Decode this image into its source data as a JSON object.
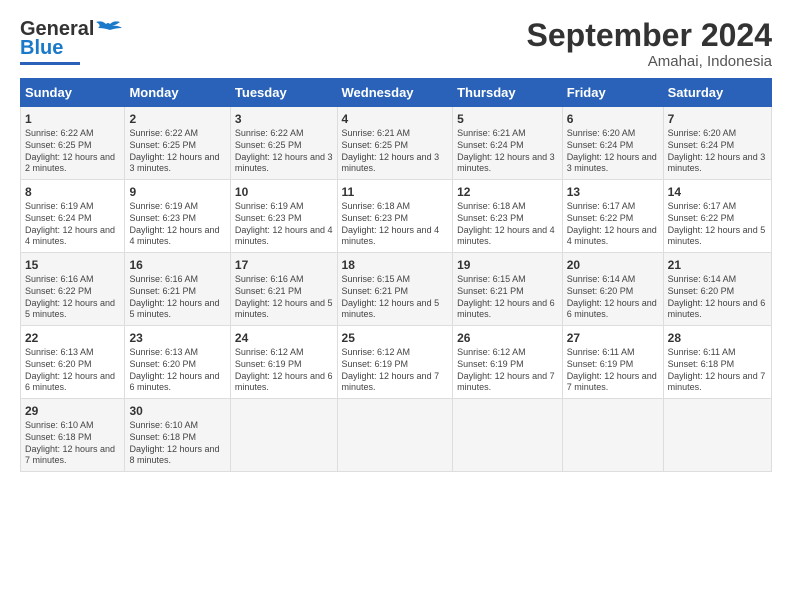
{
  "logo": {
    "line1": "General",
    "line2": "Blue"
  },
  "title": "September 2024",
  "subtitle": "Amahai, Indonesia",
  "days": [
    "Sunday",
    "Monday",
    "Tuesday",
    "Wednesday",
    "Thursday",
    "Friday",
    "Saturday"
  ],
  "weeks": [
    [
      {
        "num": "1",
        "rise": "6:22 AM",
        "set": "6:25 PM",
        "daylight": "12 hours and 2 minutes."
      },
      {
        "num": "2",
        "rise": "6:22 AM",
        "set": "6:25 PM",
        "daylight": "12 hours and 3 minutes."
      },
      {
        "num": "3",
        "rise": "6:22 AM",
        "set": "6:25 PM",
        "daylight": "12 hours and 3 minutes."
      },
      {
        "num": "4",
        "rise": "6:21 AM",
        "set": "6:25 PM",
        "daylight": "12 hours and 3 minutes."
      },
      {
        "num": "5",
        "rise": "6:21 AM",
        "set": "6:24 PM",
        "daylight": "12 hours and 3 minutes."
      },
      {
        "num": "6",
        "rise": "6:20 AM",
        "set": "6:24 PM",
        "daylight": "12 hours and 3 minutes."
      },
      {
        "num": "7",
        "rise": "6:20 AM",
        "set": "6:24 PM",
        "daylight": "12 hours and 3 minutes."
      }
    ],
    [
      {
        "num": "8",
        "rise": "6:19 AM",
        "set": "6:24 PM",
        "daylight": "12 hours and 4 minutes."
      },
      {
        "num": "9",
        "rise": "6:19 AM",
        "set": "6:23 PM",
        "daylight": "12 hours and 4 minutes."
      },
      {
        "num": "10",
        "rise": "6:19 AM",
        "set": "6:23 PM",
        "daylight": "12 hours and 4 minutes."
      },
      {
        "num": "11",
        "rise": "6:18 AM",
        "set": "6:23 PM",
        "daylight": "12 hours and 4 minutes."
      },
      {
        "num": "12",
        "rise": "6:18 AM",
        "set": "6:23 PM",
        "daylight": "12 hours and 4 minutes."
      },
      {
        "num": "13",
        "rise": "6:17 AM",
        "set": "6:22 PM",
        "daylight": "12 hours and 4 minutes."
      },
      {
        "num": "14",
        "rise": "6:17 AM",
        "set": "6:22 PM",
        "daylight": "12 hours and 5 minutes."
      }
    ],
    [
      {
        "num": "15",
        "rise": "6:16 AM",
        "set": "6:22 PM",
        "daylight": "12 hours and 5 minutes."
      },
      {
        "num": "16",
        "rise": "6:16 AM",
        "set": "6:21 PM",
        "daylight": "12 hours and 5 minutes."
      },
      {
        "num": "17",
        "rise": "6:16 AM",
        "set": "6:21 PM",
        "daylight": "12 hours and 5 minutes."
      },
      {
        "num": "18",
        "rise": "6:15 AM",
        "set": "6:21 PM",
        "daylight": "12 hours and 5 minutes."
      },
      {
        "num": "19",
        "rise": "6:15 AM",
        "set": "6:21 PM",
        "daylight": "12 hours and 6 minutes."
      },
      {
        "num": "20",
        "rise": "6:14 AM",
        "set": "6:20 PM",
        "daylight": "12 hours and 6 minutes."
      },
      {
        "num": "21",
        "rise": "6:14 AM",
        "set": "6:20 PM",
        "daylight": "12 hours and 6 minutes."
      }
    ],
    [
      {
        "num": "22",
        "rise": "6:13 AM",
        "set": "6:20 PM",
        "daylight": "12 hours and 6 minutes."
      },
      {
        "num": "23",
        "rise": "6:13 AM",
        "set": "6:20 PM",
        "daylight": "12 hours and 6 minutes."
      },
      {
        "num": "24",
        "rise": "6:12 AM",
        "set": "6:19 PM",
        "daylight": "12 hours and 6 minutes."
      },
      {
        "num": "25",
        "rise": "6:12 AM",
        "set": "6:19 PM",
        "daylight": "12 hours and 7 minutes."
      },
      {
        "num": "26",
        "rise": "6:12 AM",
        "set": "6:19 PM",
        "daylight": "12 hours and 7 minutes."
      },
      {
        "num": "27",
        "rise": "6:11 AM",
        "set": "6:19 PM",
        "daylight": "12 hours and 7 minutes."
      },
      {
        "num": "28",
        "rise": "6:11 AM",
        "set": "6:18 PM",
        "daylight": "12 hours and 7 minutes."
      }
    ],
    [
      {
        "num": "29",
        "rise": "6:10 AM",
        "set": "6:18 PM",
        "daylight": "12 hours and 7 minutes."
      },
      {
        "num": "30",
        "rise": "6:10 AM",
        "set": "6:18 PM",
        "daylight": "12 hours and 8 minutes."
      },
      null,
      null,
      null,
      null,
      null
    ]
  ]
}
